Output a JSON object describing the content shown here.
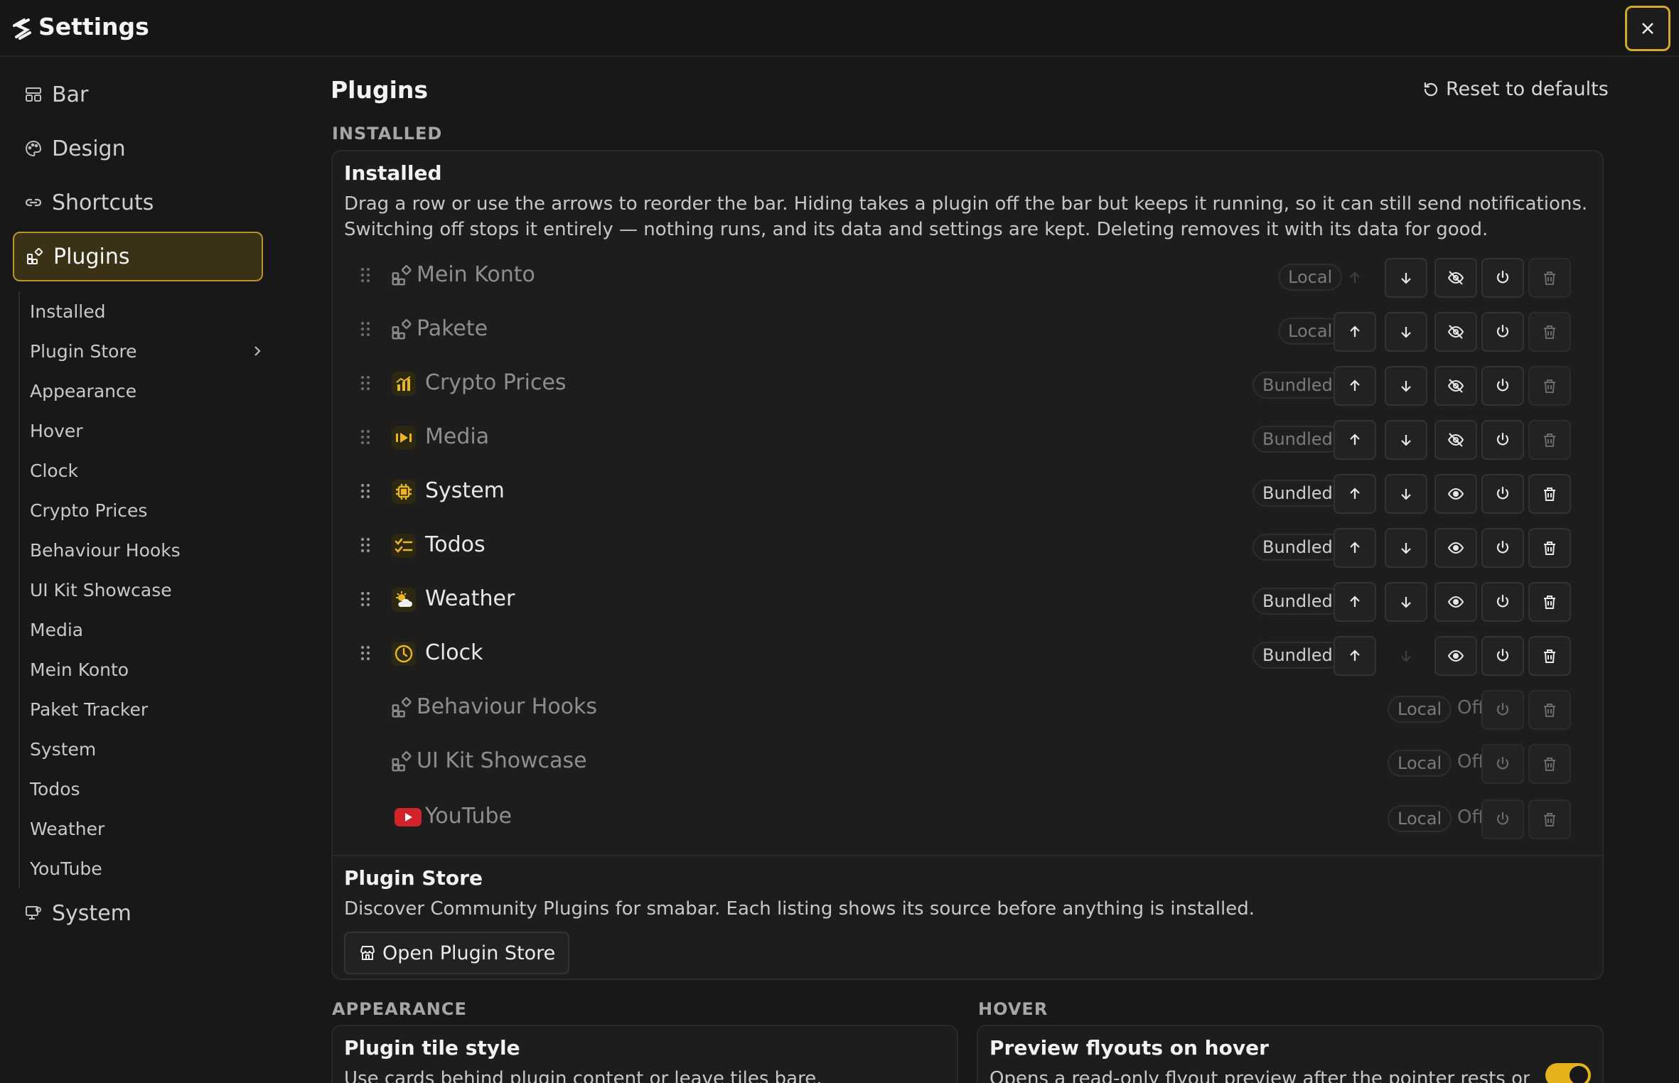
{
  "window": {
    "title": "Settings",
    "close_icon": "close-icon",
    "logo_icon": "smabar-logo-icon"
  },
  "colors": {
    "accent": "#e5b21b",
    "background": "#181818",
    "card": "#1d1d1d"
  },
  "sidebar": {
    "nav": [
      {
        "label": "Bar",
        "icon": "bar-layout-icon"
      },
      {
        "label": "Design",
        "icon": "palette-icon"
      },
      {
        "label": "Shortcuts",
        "icon": "link-icon"
      },
      {
        "label": "Plugins",
        "icon": "plugins-icon",
        "active": true
      },
      {
        "label": "System",
        "icon": "monitor-icon"
      }
    ],
    "subitems": [
      "Installed",
      "Plugin Store",
      "Appearance",
      "Hover",
      "Clock",
      "Crypto Prices",
      "Behaviour Hooks",
      "UI Kit Showcase",
      "Media",
      "Mein Konto",
      "Paket Tracker",
      "System",
      "Todos",
      "Weather",
      "YouTube"
    ]
  },
  "main": {
    "title": "Plugins",
    "reset_label": "Reset to defaults",
    "installed_section_label": "INSTALLED",
    "installed": {
      "title": "Installed",
      "description_line1": "Drag a row or use the arrows to reorder the bar. Hiding takes a plugin off the bar but keeps it running, so it can still send notifications.",
      "description_line2": "Switching off stops it entirely — nothing runs, and its data and settings are kept. Deleting removes it with its data for good.",
      "plugins": [
        {
          "name": "Mein Konto",
          "source": "Local",
          "status": "hidden",
          "icon": "plugin-generic-icon"
        },
        {
          "name": "Pakete",
          "source": "Local",
          "status": "hidden",
          "icon": "plugin-generic-icon"
        },
        {
          "name": "Crypto Prices",
          "source": "Bundled",
          "status": "hidden",
          "icon": "chart-icon"
        },
        {
          "name": "Media",
          "source": "Bundled",
          "status": "hidden",
          "icon": "media-play-icon"
        },
        {
          "name": "System",
          "source": "Bundled",
          "status": "visible",
          "icon": "chip-icon"
        },
        {
          "name": "Todos",
          "source": "Bundled",
          "status": "visible",
          "icon": "checklist-icon"
        },
        {
          "name": "Weather",
          "source": "Bundled",
          "status": "visible",
          "icon": "weather-icon"
        },
        {
          "name": "Clock",
          "source": "Bundled",
          "status": "visible",
          "icon": "clock-icon"
        },
        {
          "name": "Behaviour Hooks",
          "source": "Local",
          "status": "off",
          "off_label": "Off",
          "icon": "plugin-generic-icon"
        },
        {
          "name": "UI Kit Showcase",
          "source": "Local",
          "status": "off",
          "off_label": "Off",
          "icon": "plugin-generic-icon"
        },
        {
          "name": "YouTube",
          "source": "Local",
          "status": "off",
          "off_label": "Off",
          "icon": "youtube-icon"
        }
      ]
    },
    "store": {
      "title": "Plugin Store",
      "description": "Discover Community Plugins for smabar. Each listing shows its source before anything is installed.",
      "button_label": "Open Plugin Store"
    },
    "appearance_section_label": "APPEARANCE",
    "appearance": {
      "title": "Plugin tile style",
      "description": "Use cards behind plugin content or leave tiles bare."
    },
    "hover_section_label": "HOVER",
    "hover": {
      "title": "Preview flyouts on hover",
      "description": "Opens a read-only flyout preview after the pointer rests on a",
      "toggle_on": true
    }
  }
}
